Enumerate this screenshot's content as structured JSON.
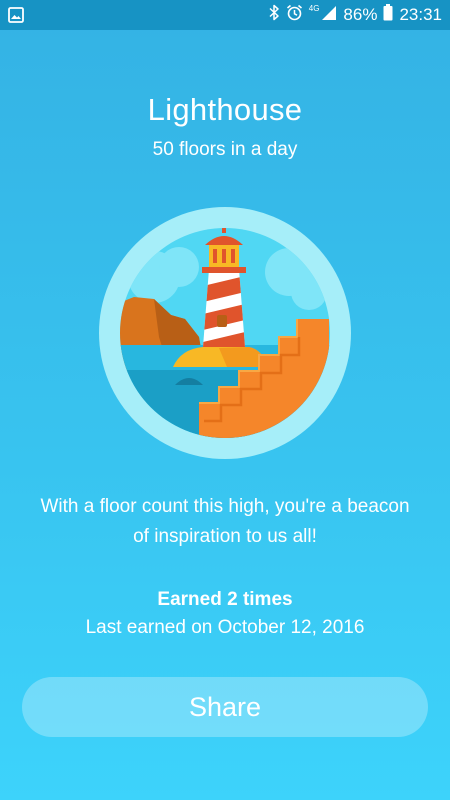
{
  "status_bar": {
    "network": "4G",
    "battery": "86%",
    "time": "23:31",
    "icons": [
      "gallery-icon",
      "bluetooth-icon",
      "alarm-icon",
      "signal-icon",
      "battery-icon"
    ]
  },
  "badge": {
    "title": "Lighthouse",
    "subtitle": "50 floors in a day",
    "image_icon": "lighthouse-badge-icon",
    "message": "With a floor count this high, you're a beacon of inspiration to us all!",
    "earned_count": "Earned 2 times",
    "last_earned": "Last earned on October 12, 2016"
  },
  "actions": {
    "share_label": "Share"
  },
  "colors": {
    "status_bar": "#1793c4",
    "background_top": "#34b2e4",
    "background_bottom": "#3dd3fb",
    "badge_ring": "#a6eef9",
    "lighthouse_red": "#e0542c",
    "stairs_orange": "#f5862a",
    "sea_blue": "#1b9fc6"
  }
}
